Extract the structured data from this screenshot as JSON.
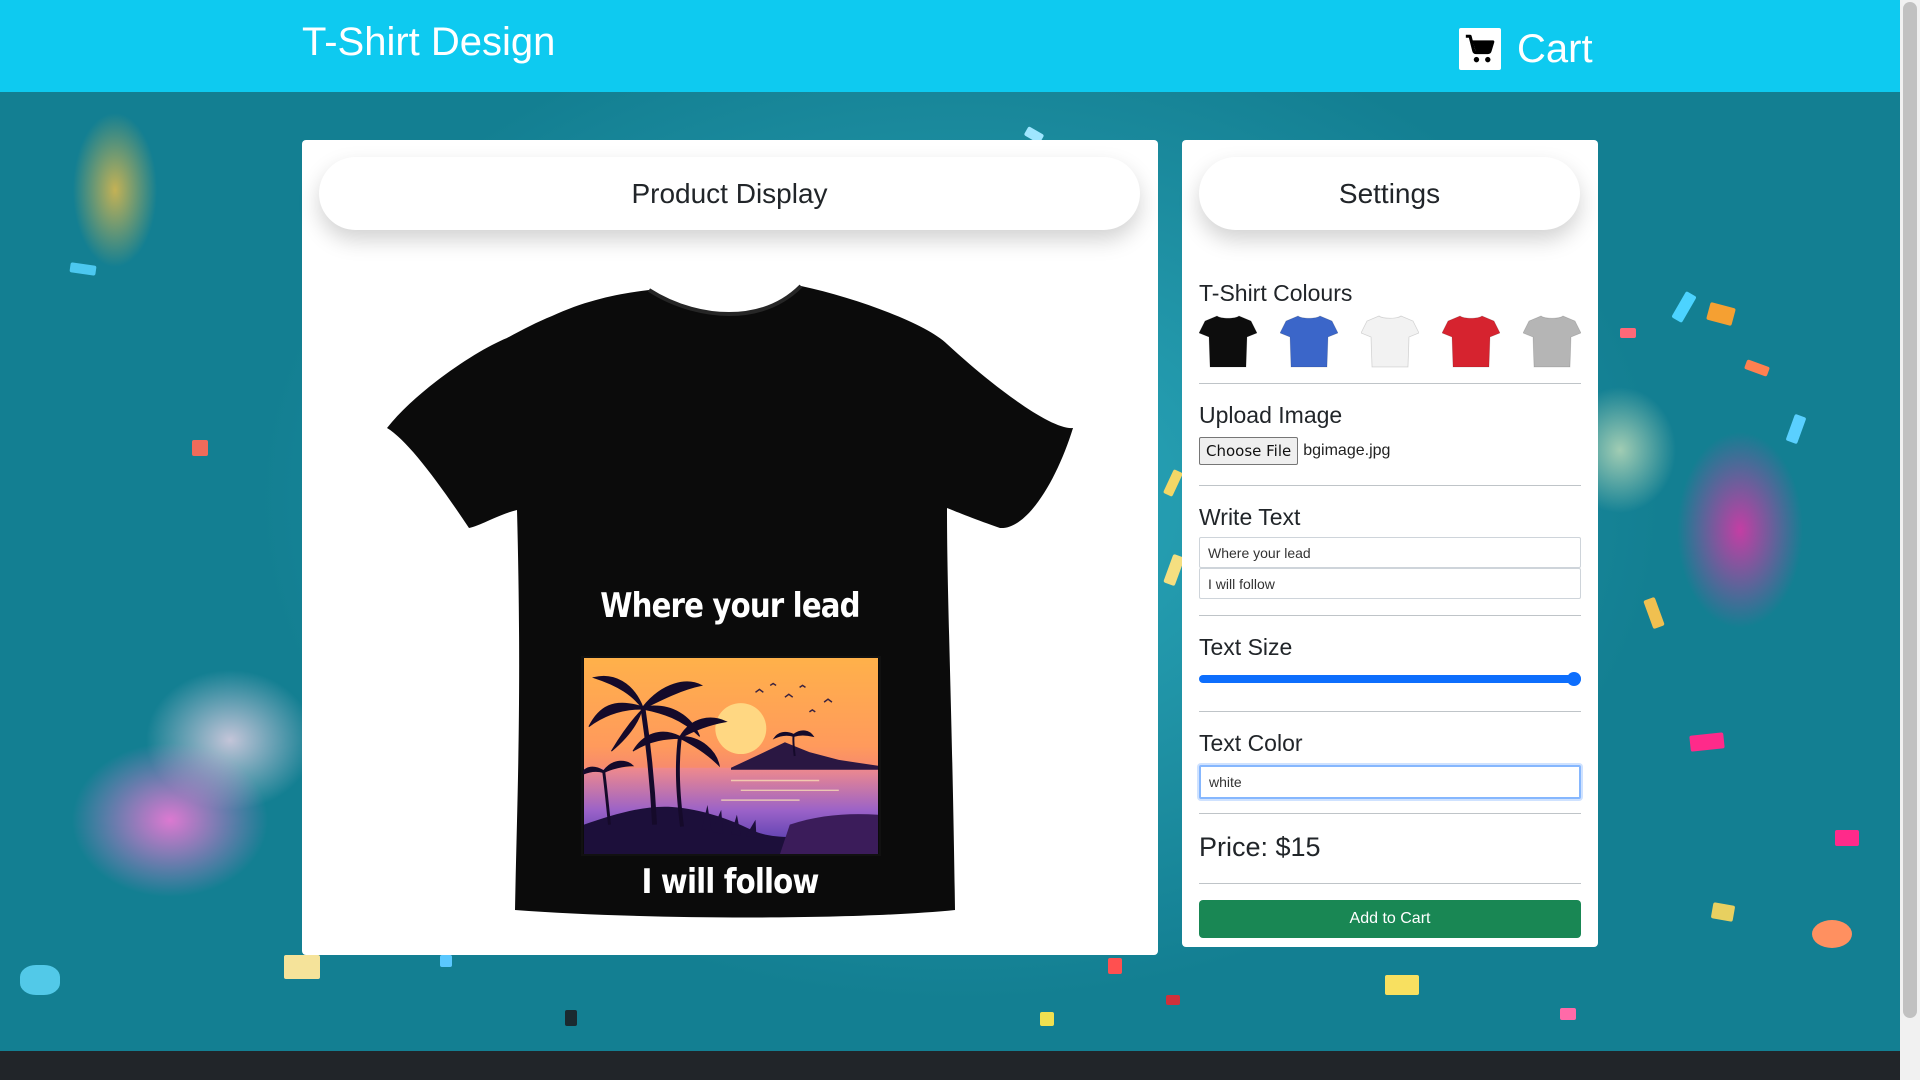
{
  "header": {
    "brand": "T-Shirt Design",
    "cart_label": "Cart"
  },
  "product": {
    "title": "Product Display",
    "shirt_color": "#0b0b0b",
    "text_line1": "Where your lead",
    "text_line2": "I will follow"
  },
  "settings": {
    "title": "Settings",
    "colours_title": "T-Shirt Colours",
    "colours": [
      "#0d0d0d",
      "#3b66c9",
      "#f2f2f2",
      "#d6232f",
      "#b5b5b5"
    ],
    "upload_title": "Upload Image",
    "choose_file_label": "Choose File",
    "file_name": "bgimage.jpg",
    "write_title": "Write Text",
    "text_line1_value": "Where your lead",
    "text_line2_value": "I will follow",
    "size_title": "Text Size",
    "text_size_level": 1.0,
    "color_title": "Text Color",
    "text_color_value": "white",
    "price_text": "Price: $15",
    "add_button_label": "Add to Cart"
  },
  "colors": {
    "header_bg": "#0ecaf0",
    "accent": "#0d6efd",
    "button": "#198754",
    "footer": "#212529"
  }
}
